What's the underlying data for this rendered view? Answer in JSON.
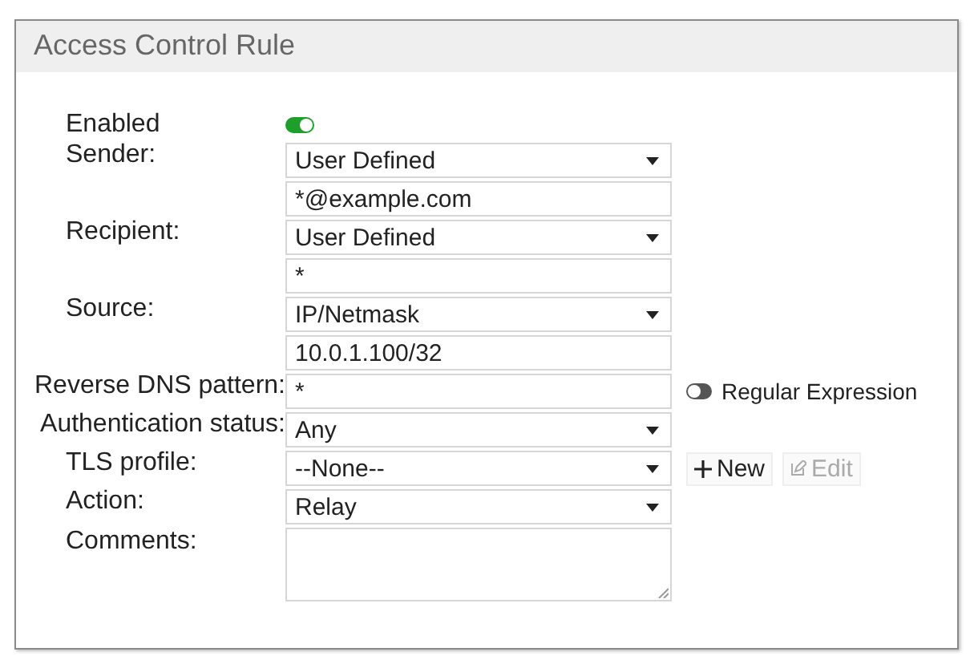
{
  "title": "Access Control Rule",
  "rows": [
    {
      "label": "Enabled",
      "kind": "toggle",
      "on": true
    },
    {
      "label": "Sender:",
      "kind": "select",
      "value": "User Defined"
    },
    {
      "kind": "text",
      "value": "*@example.com"
    },
    {
      "label": "Recipient:",
      "kind": "select",
      "value": "User Defined"
    },
    {
      "kind": "text",
      "value": "*"
    },
    {
      "label": "Source:",
      "kind": "select",
      "value": "IP/Netmask"
    },
    {
      "kind": "text",
      "value": "10.0.1.100/32"
    },
    {
      "label": "Reverse DNS pattern:",
      "kind": "text",
      "value": "*",
      "option": {
        "label": "Regular Expression",
        "on": false
      }
    },
    {
      "label": "Authentication status:",
      "kind": "select",
      "value": "Any"
    },
    {
      "label": "TLS profile:",
      "kind": "select",
      "value": "--None--",
      "buttons": [
        {
          "label": "New",
          "kind": "add",
          "disabled": false
        },
        {
          "label": "Edit",
          "kind": "edit",
          "disabled": true
        }
      ]
    },
    {
      "label": "Action:",
      "kind": "select",
      "value": "Relay"
    },
    {
      "label": "Comments:",
      "kind": "textarea"
    }
  ]
}
